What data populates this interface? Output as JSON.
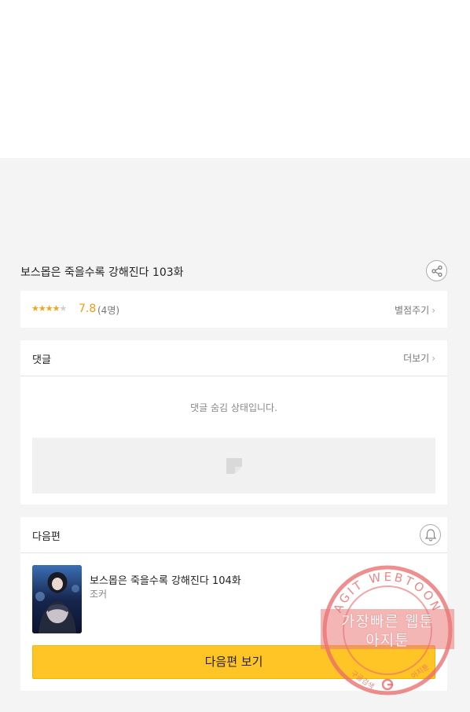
{
  "episode": {
    "title": "보스몹은 죽을수록 강해진다 103화"
  },
  "rating": {
    "stars_filled": 4,
    "stars_total": 5,
    "stars_on": "★★★★",
    "stars_off": "★",
    "score": "7.8",
    "count": "(4명)",
    "rate_label": "별점주기"
  },
  "comments": {
    "title": "댓글",
    "more_label": "더보기",
    "hidden_message": "댓글 숨김 상태입니다."
  },
  "next_episode": {
    "section_title": "다음편",
    "title": "보스몹은 죽을수록 강해진다 104화",
    "author": "조커",
    "button_label": "다음편 보기"
  },
  "watermark": {
    "ring_text": "AGIT WEBTOON",
    "line1": "가장빠른 웹툰",
    "line2": "아지툰",
    "left_small": "구글검색",
    "right_small": "아지툰"
  },
  "colors": {
    "accent_yellow": "#ffc526",
    "star_orange": "#f2a516",
    "background": "#f4f4f4",
    "watermark_red": "#e86a6a"
  },
  "icons": [
    "share-icon",
    "chevron-right-icon",
    "bell-icon",
    "image-placeholder-icon",
    "google-g-icon"
  ]
}
